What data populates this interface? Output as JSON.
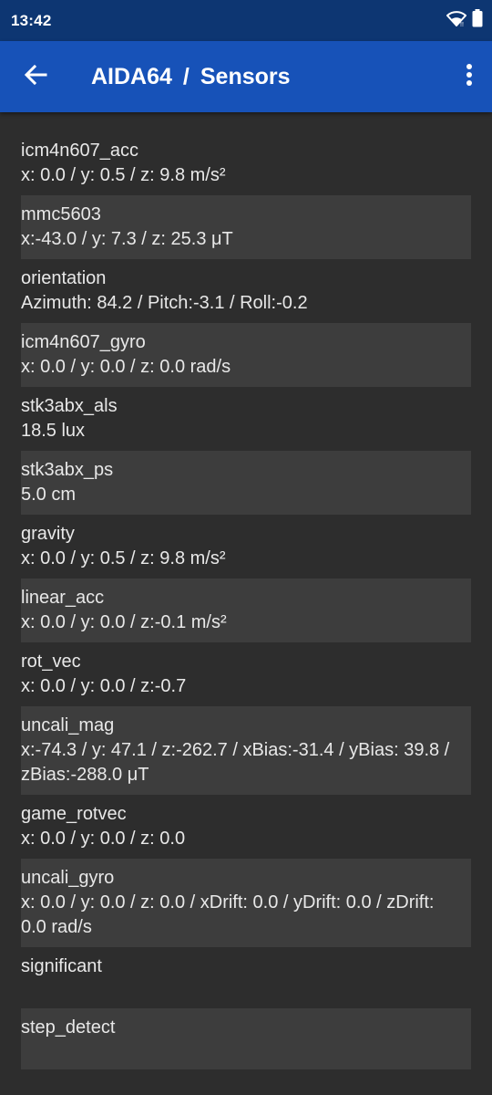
{
  "status": {
    "time": "13:42"
  },
  "appbar": {
    "app": "AIDA64",
    "separator": "/",
    "page": "Sensors"
  },
  "colors": {
    "status_bar": "#0d3672",
    "app_bar": "#1752b8",
    "background": "#2d2d2d",
    "row_alt": "#3d3d3d"
  },
  "icons": {
    "back": "arrow-left-icon",
    "menu": "more-vert-icon",
    "wifi": "wifi-icon",
    "battery": "battery-icon"
  },
  "sensors": [
    {
      "name": "icm4n607_acc",
      "value": "x: 0.0 / y: 0.5 / z: 9.8 m/s²"
    },
    {
      "name": "mmc5603",
      "value": "x:-43.0 / y: 7.3 / z: 25.3 μT"
    },
    {
      "name": "orientation",
      "value": "Azimuth: 84.2 / Pitch:-3.1 / Roll:-0.2"
    },
    {
      "name": "icm4n607_gyro",
      "value": "x: 0.0 / y: 0.0 / z: 0.0 rad/s"
    },
    {
      "name": "stk3abx_als",
      "value": "18.5 lux"
    },
    {
      "name": "stk3abx_ps",
      "value": "5.0 cm"
    },
    {
      "name": "gravity",
      "value": "x: 0.0 / y: 0.5 / z: 9.8 m/s²"
    },
    {
      "name": "linear_acc",
      "value": "x: 0.0 / y: 0.0 / z:-0.1 m/s²"
    },
    {
      "name": "rot_vec",
      "value": "x: 0.0 / y: 0.0 / z:-0.7"
    },
    {
      "name": "uncali_mag",
      "value": "x:-74.3 / y: 47.1 / z:-262.7 / xBias:-31.4 / yBias: 39.8 / zBias:-288.0 μT"
    },
    {
      "name": "game_rotvec",
      "value": "x: 0.0 / y: 0.0 / z: 0.0"
    },
    {
      "name": "uncali_gyro",
      "value": "x: 0.0 / y: 0.0 / z: 0.0 / xDrift: 0.0 / yDrift: 0.0 / zDrift: 0.0 rad/s"
    },
    {
      "name": "significant",
      "value": ""
    },
    {
      "name": "step_detect",
      "value": ""
    }
  ]
}
